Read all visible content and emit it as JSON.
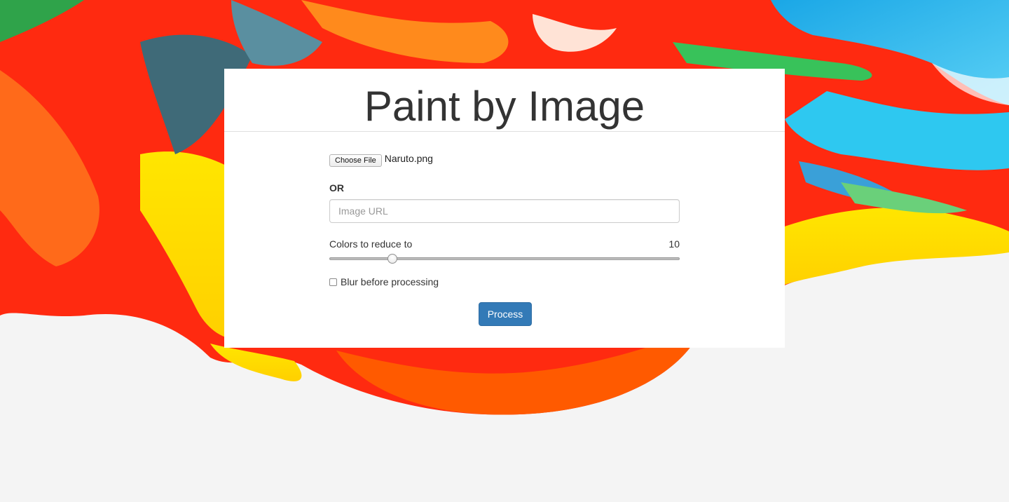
{
  "page": {
    "title": "Paint by Image"
  },
  "form": {
    "file_button_label": "Choose File",
    "file_name": "Naruto.png",
    "or_label": "OR",
    "url_placeholder": "Image URL",
    "url_value": "",
    "slider_label": "Colors to reduce to",
    "slider_value": "10",
    "slider_fraction": 0.18,
    "blur_label": "Blur before processing",
    "blur_checked": false,
    "process_label": "Process"
  },
  "colors": {
    "primary_button": "#337ab7",
    "title_text": "#333333",
    "background": "#f4f4f4"
  }
}
